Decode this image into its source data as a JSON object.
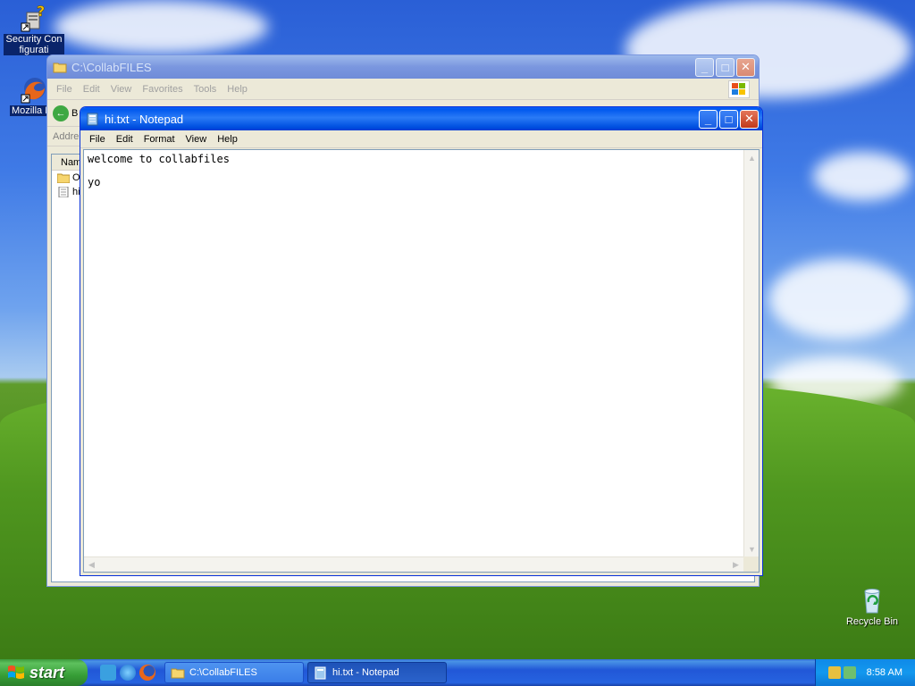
{
  "desktop": {
    "icons": [
      {
        "label": "Security Configurati",
        "icon": "security-config-icon"
      },
      {
        "label": "Mozilla Fir",
        "icon": "firefox-icon"
      },
      {
        "label": "Recycle Bin",
        "icon": "recycle-bin-icon"
      }
    ]
  },
  "explorer": {
    "title": "C:\\CollabFILES",
    "menu": [
      "File",
      "Edit",
      "View",
      "Favorites",
      "Tools",
      "Help"
    ],
    "toolbar_back_label": "B",
    "address_label": "Addre",
    "column_name": "Nam",
    "files": [
      {
        "name": "O",
        "icon": "folder-icon"
      },
      {
        "name": "hi",
        "icon": "text-file-icon"
      }
    ]
  },
  "notepad": {
    "title": "hi.txt - Notepad",
    "menu": [
      "File",
      "Edit",
      "Format",
      "View",
      "Help"
    ],
    "content": "welcome to collabfiles\n\nyo"
  },
  "taskbar": {
    "start_label": "start",
    "tasks": [
      {
        "label": "C:\\CollabFILES",
        "icon": "folder-icon",
        "active": false
      },
      {
        "label": "hi.txt - Notepad",
        "icon": "notepad-icon",
        "active": true
      }
    ],
    "clock": "8:58 AM"
  },
  "colors": {
    "titlebar_active": "#0058ee",
    "taskbar": "#2157d7",
    "start_green": "#379e37"
  }
}
